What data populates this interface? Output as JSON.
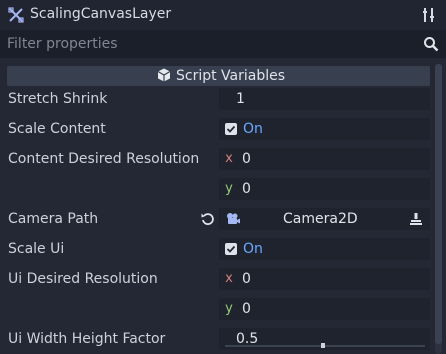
{
  "inspector": {
    "node_name": "ScalingCanvasLayer",
    "node_icon": "canvas-layer-icon",
    "tool_icon": "property-tools-icon",
    "filter_placeholder": "Filter properties",
    "search_icon": "search-icon"
  },
  "section": {
    "icon": "script-cube-icon",
    "label": "Script Variables"
  },
  "properties": {
    "stretch_shrink": {
      "label": "Stretch Shrink",
      "value": "1"
    },
    "scale_content": {
      "label": "Scale Content",
      "checked": true,
      "state": "On"
    },
    "content_desired_resolution": {
      "label": "Content Desired Resolution",
      "x_label": "x",
      "x": "0",
      "y_label": "y",
      "y": "0"
    },
    "camera_path": {
      "label": "Camera Path",
      "value": "Camera2D",
      "reset_icon": "reset-icon",
      "node_icon": "camera2d-icon",
      "assign_icon": "assign-node-icon"
    },
    "scale_ui": {
      "label": "Scale Ui",
      "checked": true,
      "state": "On"
    },
    "ui_desired_resolution": {
      "label": "Ui Desired Resolution",
      "x_label": "x",
      "x": "0",
      "y_label": "y",
      "y": "0"
    },
    "ui_width_height_factor": {
      "label": "Ui Width Height Factor",
      "value": "0.5",
      "fraction": 0.5
    }
  }
}
